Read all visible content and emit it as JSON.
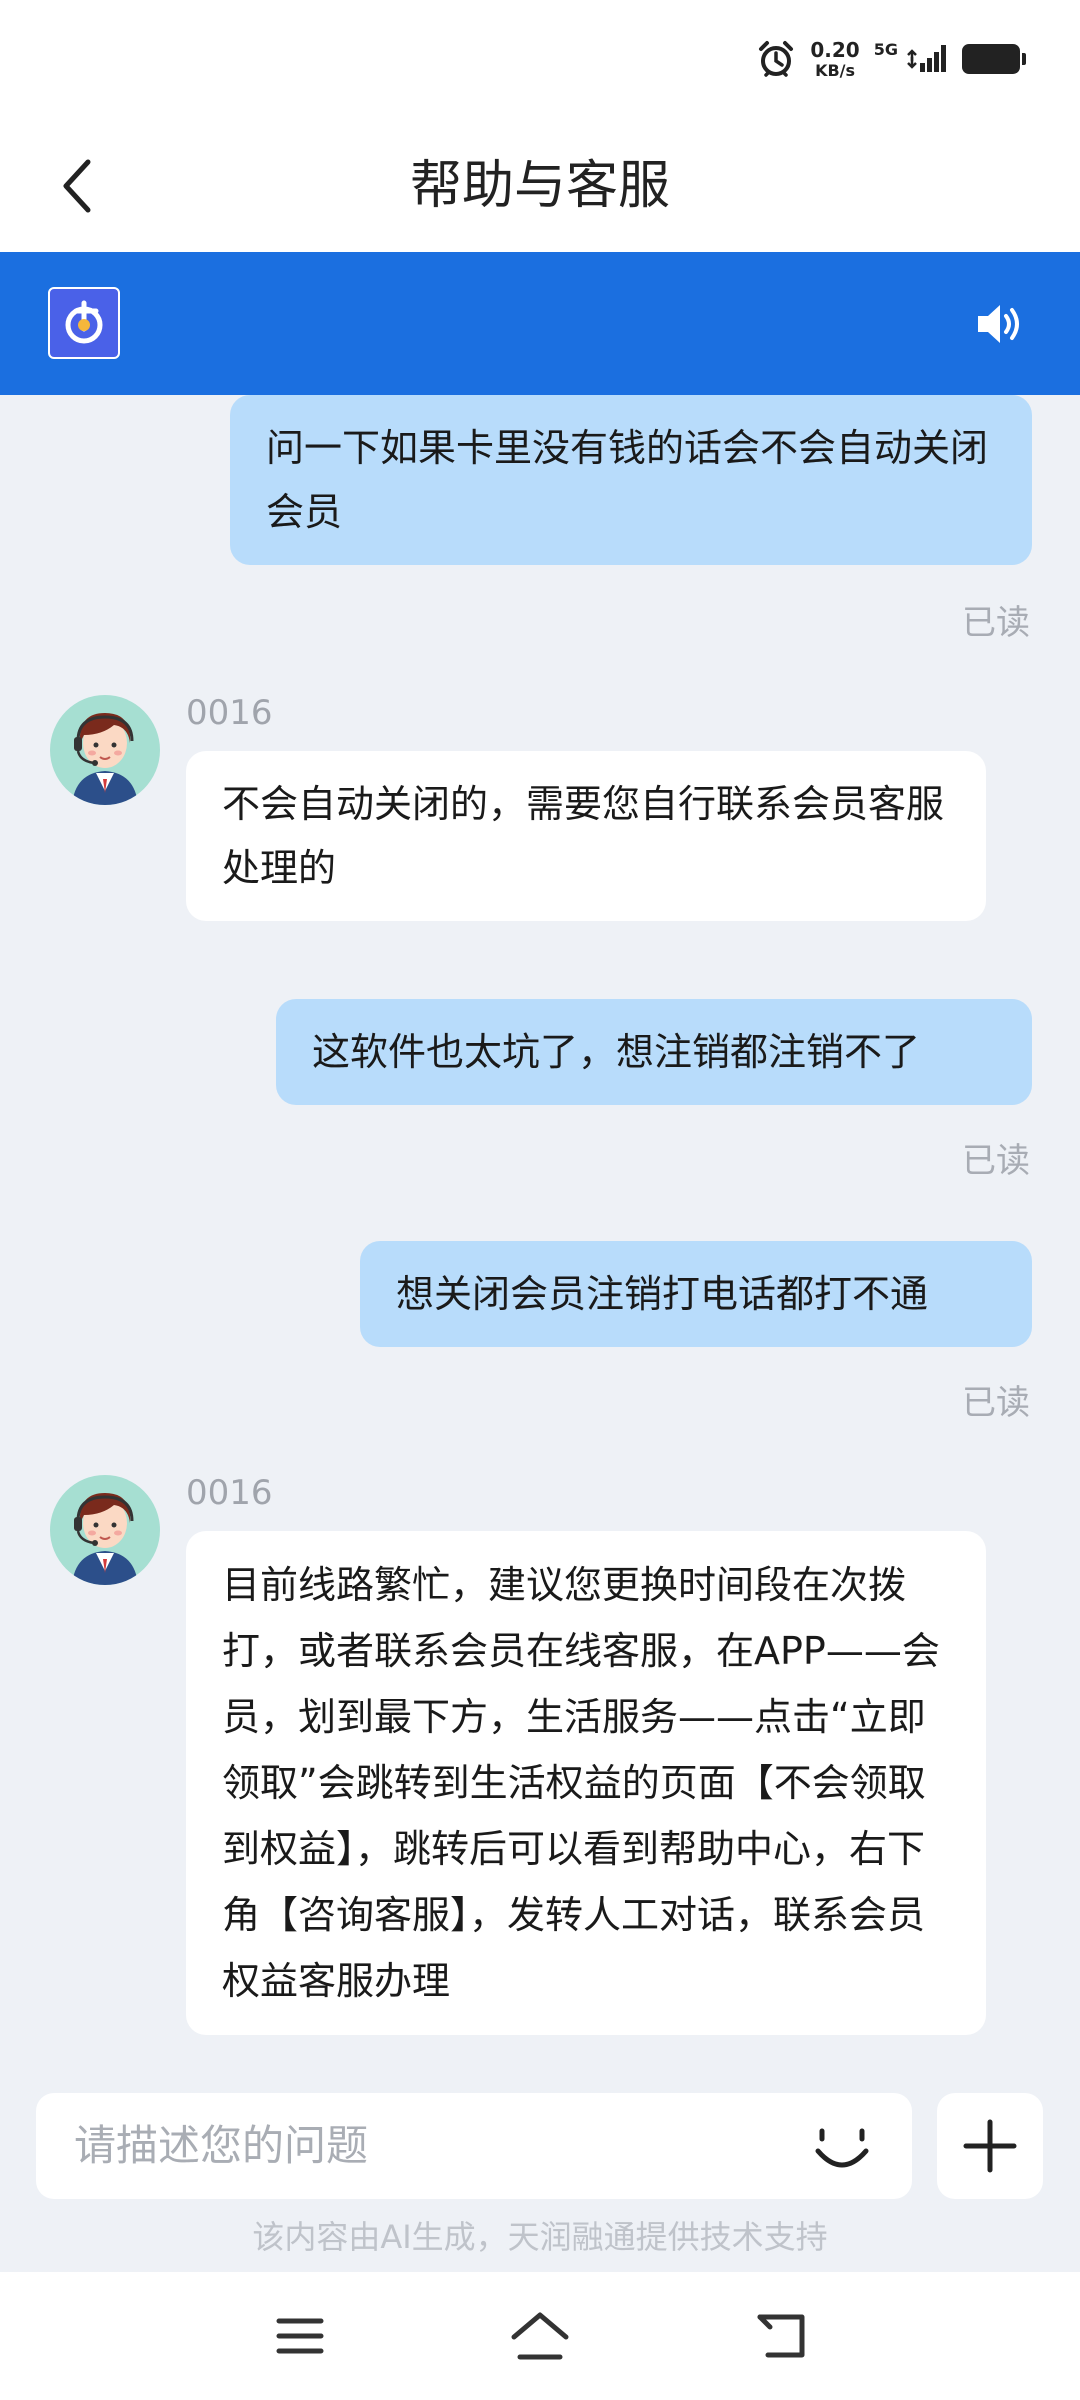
{
  "status": {
    "speed_value": "0.20",
    "speed_unit": "KB/s",
    "network": "5G",
    "icons": [
      "alarm-icon",
      "signal-icon",
      "battery-icon"
    ]
  },
  "header": {
    "title": "帮助与客服",
    "back_icon": "chevron-left-icon"
  },
  "service_bar": {
    "logo_icon": "app-logo-icon",
    "speaker_icon": "speaker-icon",
    "color": "#1b6fe0"
  },
  "messages": [
    {
      "side": "out",
      "text": "问一下如果卡里没有钱的话会不会自动关闭会员",
      "status": "已读"
    },
    {
      "side": "in",
      "agent": "0016",
      "text": "不会自动关闭的，需要您自行联系会员客服处理的"
    },
    {
      "side": "out",
      "text": "这软件也太坑了，想注销都注销不了",
      "status": "已读"
    },
    {
      "side": "out",
      "text": "想关闭会员注销打电话都打不通",
      "status": "已读"
    },
    {
      "side": "in",
      "agent": "0016",
      "text": "目前线路繁忙，建议您更换时间段在次拨打，或者联系会员在线客服，在APP——会员，划到最下方，生活服务——点击“立即领取”会跳转到生活权益的页面【不会领取到权益】，跳转后可以看到帮助中心，右下角【咨询客服】，发转人工对话，联系会员权益客服办理"
    }
  ],
  "input": {
    "placeholder": "请描述您的问题",
    "emoji_icon": "smiley-icon",
    "plus_icon": "plus-icon"
  },
  "disclaimer": "该内容由AI生成，天润融通提供技术支持",
  "nav": {
    "icons": [
      "menu-icon",
      "home-icon",
      "back-icon"
    ]
  },
  "colors": {
    "outgoing_bubble": "#b8dcfb",
    "incoming_bubble": "#ffffff",
    "background": "#eef1f6"
  }
}
